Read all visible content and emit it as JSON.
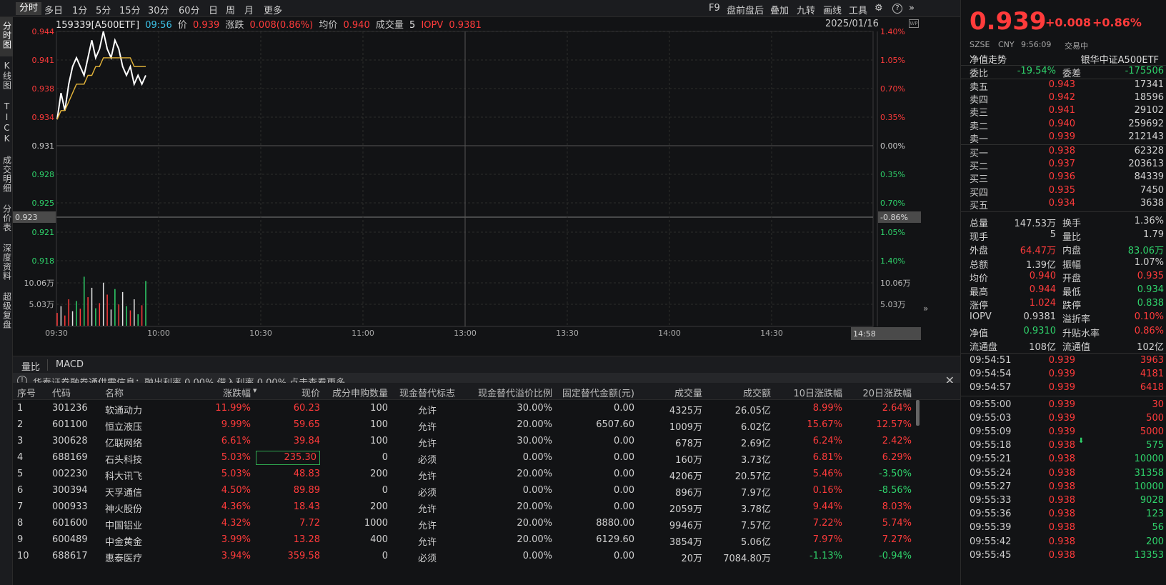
{
  "toolbar": {
    "tabs_left": [
      "分时",
      "多日",
      "1分",
      "5分",
      "15分",
      "30分",
      "60分",
      "日",
      "周",
      "月",
      "更多"
    ],
    "tabs_right": [
      "F9",
      "盘前盘后",
      "叠加",
      "九转",
      "画线",
      "工具"
    ]
  },
  "left_vtabs": [
    "分时图",
    "K线图",
    "TICK",
    "成交明细",
    "分价表",
    "深度资料",
    "超级复盘"
  ],
  "info": {
    "code": "159339[A500ETF]",
    "time": "09:56",
    "price_label": "价",
    "price": "0.939",
    "change_label": "涨跌",
    "change": "0.008(0.86%)",
    "avg_label": "均价",
    "avg": "0.940",
    "vol_label": "成交量",
    "vol": "5",
    "iopv_label": "IOPV",
    "iopv": "0.9381",
    "date": "2025/01/16"
  },
  "chart_data": {
    "type": "line",
    "prev_close": 0.931,
    "ylim": [
      0.918,
      0.944
    ],
    "y_left_ticks": [
      "0.944",
      "0.941",
      "0.938",
      "0.934",
      "0.931",
      "0.928",
      "0.925",
      "0.923",
      "0.921",
      "0.918"
    ],
    "y_right_ticks": [
      "1.40%",
      "1.05%",
      "0.70%",
      "0.35%",
      "0.00%",
      "0.35%",
      "0.70%",
      "-0.86%",
      "1.05%",
      "1.40%"
    ],
    "volume_ticks": [
      "10.06万",
      "5.03万"
    ],
    "x_ticks": [
      "09:30",
      "10:00",
      "10:30",
      "11:00",
      "13:00",
      "13:30",
      "14:00",
      "14:30"
    ],
    "cursor_time": "14:58",
    "cursor_price": "0.923",
    "series": [
      {
        "values": [
          0.934,
          0.937,
          0.935,
          0.938,
          0.94,
          0.941,
          0.94,
          0.939,
          0.941,
          0.943,
          0.941,
          0.942,
          0.944,
          0.942,
          0.941,
          0.943,
          0.942,
          0.94,
          0.939,
          0.94,
          0.938,
          0.939,
          0.938,
          0.939
        ]
      },
      {
        "values": [
          0.934,
          0.935,
          0.935,
          0.936,
          0.937,
          0.938,
          0.938,
          0.938,
          0.939,
          0.939,
          0.94,
          0.94,
          0.941,
          0.941,
          0.941,
          0.941,
          0.941,
          0.941,
          0.941,
          0.941,
          0.94,
          0.94,
          0.94,
          0.94
        ]
      }
    ],
    "volume": [
      3.0,
      4.6,
      2.4,
      6.2,
      3.4,
      5.8,
      4.0,
      11.5,
      6.7,
      8.9,
      4.1,
      5.3,
      10.1,
      7.3,
      3.8,
      8.6,
      5.0,
      7.9,
      4.6,
      3.6,
      6.2,
      2.7,
      4.8,
      10.5
    ],
    "volume_colors": [
      "r",
      "w",
      "r",
      "r",
      "w",
      "g",
      "r",
      "g",
      "r",
      "w",
      "g",
      "r",
      "w",
      "r",
      "w",
      "g",
      "r",
      "w",
      "g",
      "r",
      "w",
      "g",
      "r",
      "g"
    ]
  },
  "bottom_tabs": [
    "量比",
    "MACD"
  ],
  "notice": {
    "icon": "!",
    "text": "华泰证券融券通供需信息：融出利率 0.00%  借入利率 0.00%  点击查看更多"
  },
  "table": {
    "headers": [
      "序号",
      "代码",
      "名称",
      "涨跌幅",
      "现价",
      "成分申购数量",
      "现金替代标志",
      "现金替代溢价比例",
      "固定替代金额(元)",
      "成交量",
      "成交额",
      "10日涨跌幅",
      "20日涨跌幅"
    ],
    "rows": [
      [
        "1",
        "301236",
        "软通动力",
        "11.99%",
        "60.23",
        "100",
        "允许",
        "30.00%",
        "0.00",
        "4325万",
        "26.05亿",
        "8.99%",
        "2.64%"
      ],
      [
        "2",
        "601100",
        "恒立液压",
        "9.99%",
        "59.65",
        "100",
        "允许",
        "20.00%",
        "6507.60",
        "1009万",
        "6.02亿",
        "15.67%",
        "12.57%"
      ],
      [
        "3",
        "300628",
        "亿联网络",
        "6.61%",
        "39.84",
        "100",
        "允许",
        "30.00%",
        "0.00",
        "678万",
        "2.69亿",
        "6.24%",
        "2.42%"
      ],
      [
        "4",
        "688169",
        "石头科技",
        "5.03%",
        "235.30",
        "0",
        "必须",
        "0.00%",
        "0.00",
        "160万",
        "3.73亿",
        "6.81%",
        "6.29%"
      ],
      [
        "5",
        "002230",
        "科大讯飞",
        "5.03%",
        "48.83",
        "200",
        "允许",
        "20.00%",
        "0.00",
        "4206万",
        "20.57亿",
        "5.46%",
        "-3.50%"
      ],
      [
        "6",
        "300394",
        "天孚通信",
        "4.50%",
        "89.89",
        "0",
        "必须",
        "0.00%",
        "0.00",
        "896万",
        "7.97亿",
        "0.16%",
        "-8.56%"
      ],
      [
        "7",
        "000933",
        "神火股份",
        "4.36%",
        "18.43",
        "200",
        "允许",
        "20.00%",
        "0.00",
        "2059万",
        "3.78亿",
        "9.44%",
        "8.03%"
      ],
      [
        "8",
        "601600",
        "中国铝业",
        "4.32%",
        "7.72",
        "1000",
        "允许",
        "20.00%",
        "8880.00",
        "9946万",
        "7.57亿",
        "7.22%",
        "5.74%"
      ],
      [
        "9",
        "600489",
        "中金黄金",
        "3.99%",
        "13.28",
        "400",
        "允许",
        "20.00%",
        "6129.60",
        "3854万",
        "5.06亿",
        "7.97%",
        "7.27%"
      ],
      [
        "10",
        "688617",
        "惠泰医疗",
        "3.94%",
        "359.58",
        "0",
        "必须",
        "0.00%",
        "0.00",
        "20万",
        "7084.80万",
        "-1.13%",
        "-0.94%"
      ]
    ]
  },
  "quote": {
    "price": "0.939",
    "change": "+0.008",
    "change_pct": "+0.86%",
    "market": "SZSE",
    "currency": "CNY",
    "time": "9:56:09",
    "status": "交易中",
    "nav_trend": "净值走势",
    "name": "银华中证A500ETF",
    "weibi_label": "委比",
    "weibi": "-19.54%",
    "weicha_label": "委差",
    "weicha": "-175506",
    "asks": [
      [
        "卖五",
        "0.943",
        "17341"
      ],
      [
        "卖四",
        "0.942",
        "18596"
      ],
      [
        "卖三",
        "0.941",
        "29102"
      ],
      [
        "卖二",
        "0.940",
        "259692"
      ],
      [
        "卖一",
        "0.939",
        "212143"
      ]
    ],
    "bids": [
      [
        "买一",
        "0.938",
        "62328"
      ],
      [
        "买二",
        "0.937",
        "203613"
      ],
      [
        "买三",
        "0.936",
        "84339"
      ],
      [
        "买四",
        "0.935",
        "7450"
      ],
      [
        "买五",
        "0.934",
        "3638"
      ]
    ],
    "stats": [
      [
        "总量",
        "147.53万",
        "换手",
        "1.36%"
      ],
      [
        "现手",
        "5",
        "量比",
        "1.79"
      ],
      [
        "外盘",
        "64.47万",
        "内盘",
        "83.06万"
      ],
      [
        "总额",
        "1.39亿",
        "振幅",
        "1.07%"
      ],
      [
        "均价",
        "0.940",
        "开盘",
        "0.935"
      ],
      [
        "最高",
        "0.944",
        "最低",
        "0.934"
      ],
      [
        "涨停",
        "1.024",
        "跌停",
        "0.838"
      ],
      [
        "IOPV",
        "0.9381",
        "溢折率",
        "0.10%"
      ],
      [
        "净值",
        "0.9310",
        "升贴水率",
        "0.86%"
      ],
      [
        "流通盘",
        "108亿",
        "流通值",
        "102亿"
      ]
    ],
    "ticks": [
      [
        "09:54:51",
        "0.939",
        "3963"
      ],
      [
        "09:54:54",
        "0.939",
        "4181"
      ],
      [
        "09:54:57",
        "0.939",
        "6418"
      ],
      [
        "09:55:00",
        "0.939",
        "30"
      ],
      [
        "09:55:03",
        "0.939",
        "500"
      ],
      [
        "09:55:09",
        "0.939",
        "5000"
      ],
      [
        "09:55:18",
        "0.938",
        "575"
      ],
      [
        "09:55:21",
        "0.938",
        "10000"
      ],
      [
        "09:55:24",
        "0.938",
        "31358"
      ],
      [
        "09:55:27",
        "0.938",
        "10000"
      ],
      [
        "09:55:33",
        "0.938",
        "9028"
      ],
      [
        "09:55:36",
        "0.938",
        "123"
      ],
      [
        "09:55:39",
        "0.938",
        "56"
      ],
      [
        "09:55:42",
        "0.938",
        "200"
      ],
      [
        "09:55:45",
        "0.938",
        "13353"
      ]
    ]
  }
}
